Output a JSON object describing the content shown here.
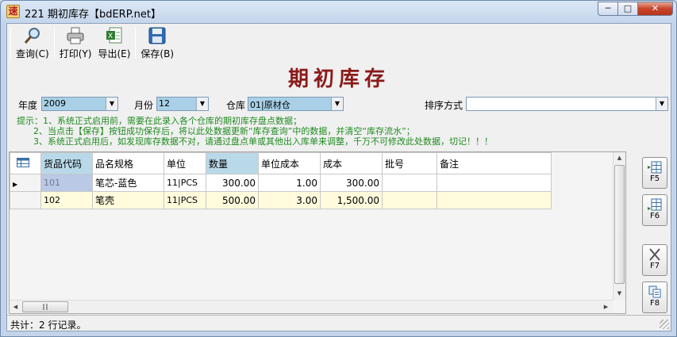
{
  "window": {
    "title": "221 期初库存【bdERP.net】",
    "app_icon_glyph": "速"
  },
  "toolbar": {
    "query_label": "查询(C)",
    "print_label": "打印(Y)",
    "export_label": "导出(E)",
    "save_label": "保存(B)"
  },
  "heading": "期初库存",
  "filters": {
    "year_label": "年度",
    "year_value": "2009",
    "month_label": "月份",
    "month_value": "12",
    "warehouse_label": "仓库",
    "warehouse_value": "01|原材仓",
    "sort_label": "排序方式",
    "sort_value": ""
  },
  "tips": [
    "提示：1、系统正式启用前，需要在此录入各个仓库的期初库存盘点数据；",
    "      2、当点击【保存】按钮成功保存后，将以此处数据更新“库存查询”中的数据，并清空“库存流水”；",
    "      3、系统正式启用后，如发现库存数据不对，请通过盘点单或其他出入库单来调整，千万不可修改此处数据，切记！！！"
  ],
  "grid": {
    "columns": [
      "货品代码",
      "品名规格",
      "单位",
      "数量",
      "单位成本",
      "成本",
      "批号",
      "备注"
    ],
    "rows": [
      {
        "code": "101",
        "name": "笔芯-蓝色",
        "unit": "11|PCS",
        "qty": "300.00",
        "unit_cost": "1.00",
        "cost": "300.00",
        "batch": "",
        "note": ""
      },
      {
        "code": "102",
        "name": "笔壳",
        "unit": "11|PCS",
        "qty": "500.00",
        "unit_cost": "3.00",
        "cost": "1,500.00",
        "batch": "",
        "note": ""
      }
    ]
  },
  "side_buttons": {
    "f5": "F5",
    "f6": "F6",
    "f7": "F7",
    "f8": "F8"
  },
  "status": {
    "text": "共计：2 行记录。"
  },
  "colors": {
    "heading": "#8b1a1a",
    "tips": "#1f8a1f",
    "highlight_header": "#b9d9e9",
    "row_alt": "#fffbdc"
  }
}
